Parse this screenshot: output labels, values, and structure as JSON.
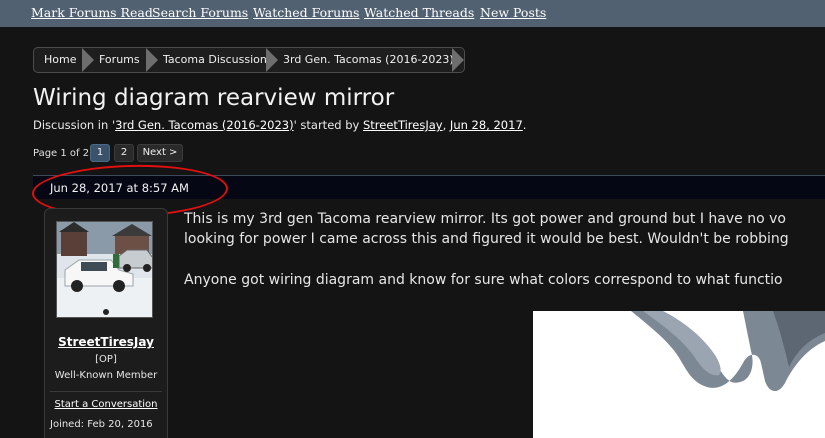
{
  "topnav": {
    "links": [
      "Mark Forums Read",
      "Search Forums",
      "Watched Forums",
      "Watched Threads",
      "New Posts"
    ]
  },
  "breadcrumb": {
    "items": [
      "Home",
      "Forums",
      "Tacoma Discussion",
      "3rd Gen. Tacomas (2016-2023)"
    ]
  },
  "thread": {
    "title": "Wiring diagram rearview mirror",
    "byline_prefix": "Discussion in '",
    "forum_link": "3rd Gen. Tacomas (2016-2023)",
    "byline_mid": "' started by ",
    "author_link": "StreetTiresJay",
    "byline_sep": ", ",
    "date_link": "Jun 28, 2017",
    "byline_end": "."
  },
  "pagination": {
    "label": "Page 1 of 2",
    "pages": [
      "1",
      "2"
    ],
    "current": "1",
    "next_label": "Next >"
  },
  "post": {
    "date": "Jun 28, 2017 at 8:57 AM",
    "author": {
      "username": "StreetTiresJay",
      "badge": "[OP]",
      "title": "Well-Known Member",
      "start_conversation": "Start a Conversation",
      "joined_label": "Joined:",
      "joined_value": "Feb 20, 2016"
    },
    "lines": [
      "This is my 3rd gen Tacoma rearview mirror. Its got power and ground but I have no vo",
      "looking for power I came across this and figured it would be best. Wouldn't be robbing",
      "Anyone got wiring diagram and know for sure what colors correspond to what functio"
    ]
  },
  "colors": {
    "topbar": "#516171",
    "background": "#141414",
    "post_header": "#050814",
    "annotation_circle": "#e01010",
    "current_page": "#3a536b"
  }
}
